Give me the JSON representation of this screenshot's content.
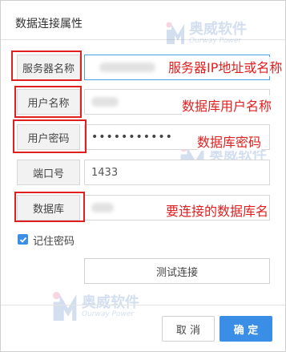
{
  "dialog": {
    "title": "数据连接属性"
  },
  "fields": {
    "server": {
      "label": "服务器名称",
      "value": ""
    },
    "user": {
      "label": "用户名称",
      "value": ""
    },
    "password": {
      "label": "用户密码",
      "value": "•••••••••••"
    },
    "port": {
      "label": "端口号",
      "value": "1433"
    },
    "database": {
      "label": "数据库",
      "value": ""
    }
  },
  "annotations": {
    "server": "服务器IP地址或名称",
    "user": "数据库用户名称",
    "password": "数据库密码",
    "database": "要连接的数据库名"
  },
  "remember": {
    "label": "记住密码",
    "checked": true
  },
  "buttons": {
    "test": "测试连接",
    "cancel": "取 消",
    "ok": "确 定"
  },
  "watermark": {
    "cn": "奥威软件",
    "en": "Ourway Power"
  },
  "colors": {
    "accent": "#3a8ee6",
    "annotation": "#e02020"
  }
}
